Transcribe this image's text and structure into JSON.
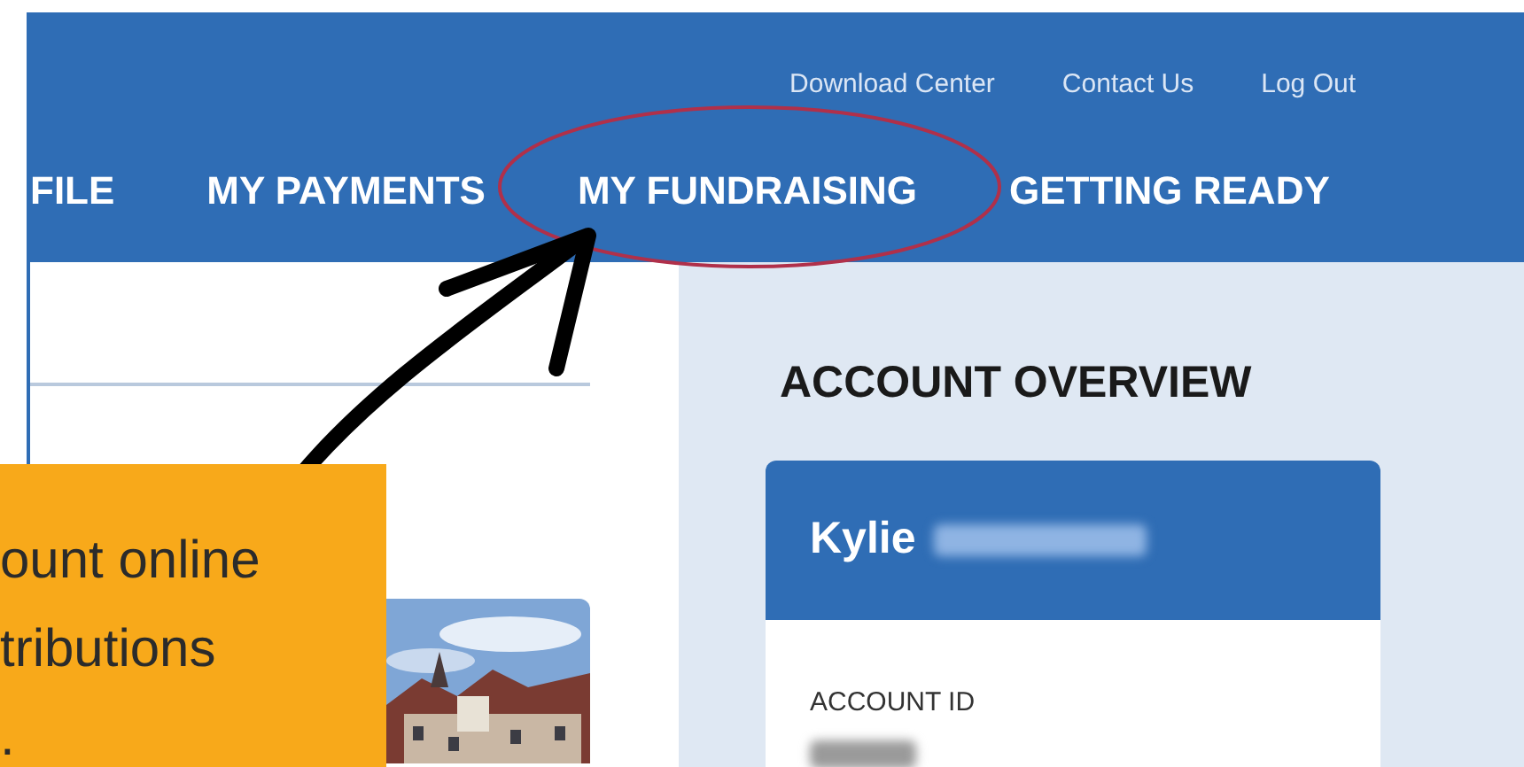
{
  "header": {
    "top_links": [
      "Download Center",
      "Contact Us",
      "Log Out"
    ],
    "nav_items": [
      "FILE",
      "MY PAYMENTS",
      "MY FUNDRAISING",
      "GETTING READY"
    ]
  },
  "account_overview": {
    "title": "ACCOUNT OVERVIEW",
    "first_name": "Kylie",
    "fields": [
      {
        "label": "ACCOUNT ID"
      }
    ]
  },
  "callout": {
    "lines": [
      "ount online",
      "tributions",
      "."
    ]
  }
}
